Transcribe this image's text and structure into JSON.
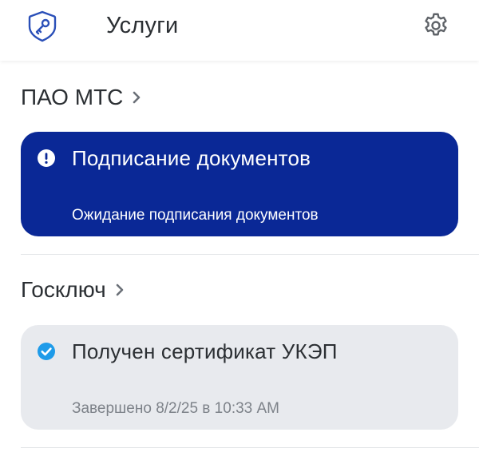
{
  "header": {
    "title": "Услуги"
  },
  "sections": [
    {
      "title": "ПАО МТС",
      "card": {
        "title": "Подписание документов",
        "subtitle": "Ожидание подписания документов"
      }
    },
    {
      "title": "Госключ",
      "card": {
        "title": "Получен сертификат УКЭП",
        "subtitle": "Завершено 8/2/25 в 10:33 AM"
      }
    }
  ],
  "icons": {
    "app": "key-icon",
    "settings": "gear-icon",
    "alert": "exclamation-circle-icon",
    "done": "check-circle-icon",
    "chevron": "chevron-right-icon"
  },
  "colors": {
    "brand_blue": "#0a2896",
    "accent_blue": "#2a5bd7",
    "check_blue": "#1e9be9",
    "card_grey": "#e8eaee"
  }
}
